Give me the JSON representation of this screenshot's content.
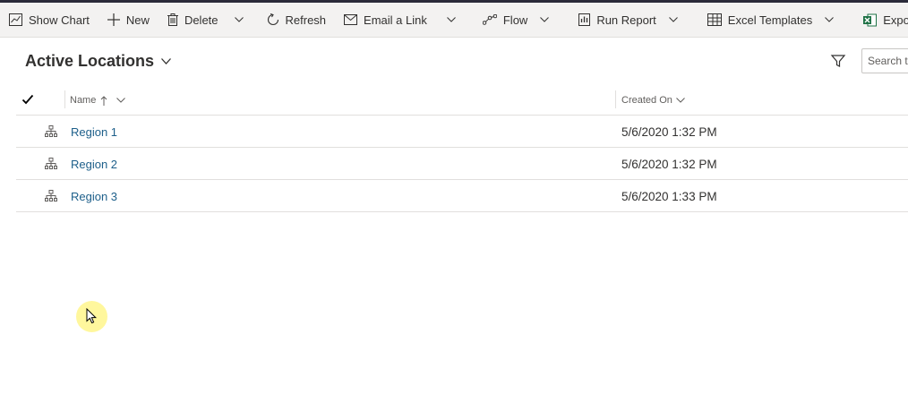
{
  "toolbar": {
    "show_chart": "Show Chart",
    "new": "New",
    "delete": "Delete",
    "refresh": "Refresh",
    "email_link": "Email a Link",
    "flow": "Flow",
    "run_report": "Run Report",
    "excel_templates": "Excel Templates",
    "export_excel": "Export to Excel"
  },
  "view": {
    "title": "Active Locations"
  },
  "search": {
    "placeholder": "Search this view"
  },
  "grid": {
    "columns": {
      "name": "Name",
      "created_on": "Created On"
    },
    "rows": [
      {
        "name": "Region 1",
        "created_on": "5/6/2020 1:32 PM"
      },
      {
        "name": "Region 2",
        "created_on": "5/6/2020 1:32 PM"
      },
      {
        "name": "Region 3",
        "created_on": "5/6/2020 1:33 PM"
      }
    ]
  },
  "icons": {
    "show_chart": "chart-icon",
    "new": "plus-icon",
    "delete": "trash-icon",
    "refresh": "refresh-icon",
    "email_link": "email-icon",
    "flow": "flow-icon",
    "run_report": "report-icon",
    "excel_templates": "excel-template-icon",
    "export_excel": "excel-icon",
    "filter": "filter-icon",
    "row": "hierarchy-icon"
  },
  "colors": {
    "link": "#1d5f8a",
    "toolbar_bg": "#f3f2f1",
    "excel_green": "#1e7145",
    "cursor_highlight": "#fff68c"
  }
}
